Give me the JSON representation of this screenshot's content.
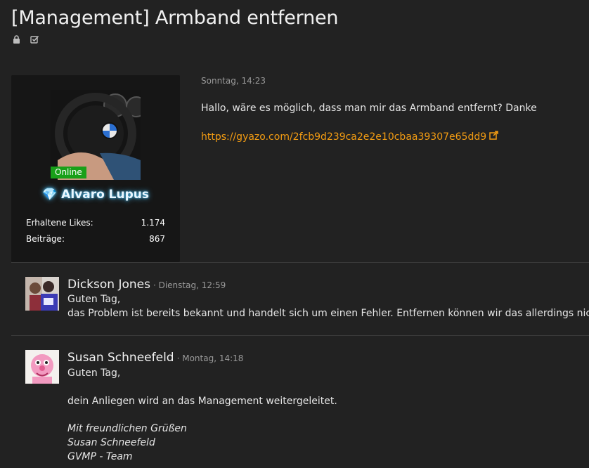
{
  "thread": {
    "title": "[Management] Armband entfernen"
  },
  "icons": {
    "lock": "lock-icon",
    "done": "checkbox-icon"
  },
  "author": {
    "status": "Online",
    "name": "Alvaro Lupus",
    "gem": "💎",
    "stats": [
      {
        "label": "Erhaltene Likes:",
        "value": "1.174"
      },
      {
        "label": "Beiträge:",
        "value": "867"
      }
    ]
  },
  "post": {
    "time": "Sonntag, 14:23",
    "text": "Hallo, wäre es möglich, dass man mir das Armband entfernt? Danke",
    "link": "https://gyazo.com/2fcb9d239ca2e2e10cbaa39307e65dd9"
  },
  "comments": [
    {
      "name": "Dickson Jones",
      "meta": "· Dienstag, 12:59",
      "lines": [
        "Guten Tag,",
        "das Problem ist bereits bekannt und handelt sich um einen Fehler. Entfernen können wir das allerdings nicht."
      ]
    },
    {
      "name": "Susan Schneefeld",
      "meta": "· Montag, 14:18",
      "lines": [
        "Guten Tag,",
        "dein Anliegen wird an das Management weitergeleitet.",
        "Mit freundlichen Grüßen",
        "Susan Schneefeld",
        "GVMP - Team"
      ]
    }
  ],
  "colors": {
    "background": "#222222",
    "card": "#161616",
    "link": "#f39c12",
    "online": "#19a019",
    "glow": "#50c8ff"
  }
}
